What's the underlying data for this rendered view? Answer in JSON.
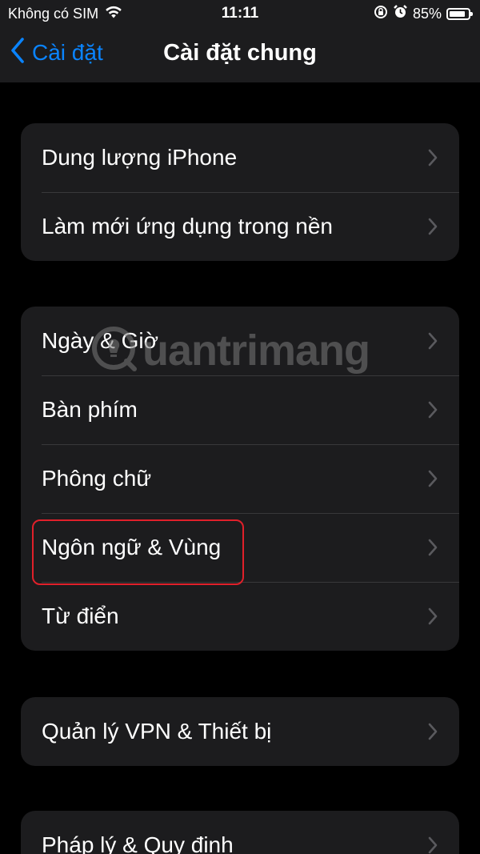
{
  "status_bar": {
    "carrier": "Không có SIM",
    "time": "11:11",
    "battery_percent": "85%",
    "battery_level": 0.85,
    "icons": [
      "wifi-icon",
      "rotation-lock-icon",
      "alarm-icon",
      "battery-icon"
    ]
  },
  "nav": {
    "back_label": "Cài đặt",
    "title": "Cài đặt chung"
  },
  "groups": [
    {
      "items": [
        {
          "label": "Dung lượng iPhone"
        },
        {
          "label": "Làm mới ứng dụng trong nền"
        }
      ]
    },
    {
      "items": [
        {
          "label": "Ngày & Giờ"
        },
        {
          "label": "Bàn phím"
        },
        {
          "label": "Phông chữ"
        },
        {
          "label": "Ngôn ngữ & Vùng",
          "highlighted": true
        },
        {
          "label": "Từ điển"
        }
      ]
    },
    {
      "items": [
        {
          "label": "Quản lý VPN & Thiết bị"
        }
      ]
    },
    {
      "items": [
        {
          "label": "Pháp lý & Quy định"
        }
      ]
    }
  ],
  "watermark": "uantrimang",
  "colors": {
    "accent": "#0a84ff",
    "highlight": "#e0202a",
    "cell_background": "#1c1c1e",
    "separator": "#38383a",
    "chevron": "#5a5a5e"
  }
}
